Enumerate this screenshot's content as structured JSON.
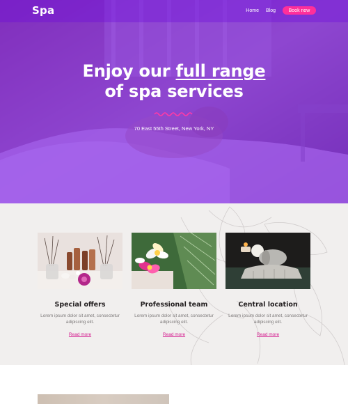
{
  "brand": {
    "logo": "Spa"
  },
  "nav": {
    "links": [
      "Home",
      "Blog"
    ],
    "cta_label": "Book now"
  },
  "hero": {
    "title_part1": "Enjoy our ",
    "title_highlight": "full range",
    "title_line2": "of spa services",
    "address": "70 East 55th Street, New York, NY"
  },
  "services": [
    {
      "title": "Special offers",
      "text": "Lorem ipsum dolor sit amet, consectetur adipiscing elit.",
      "link": "Read more"
    },
    {
      "title": "Professional team",
      "text": "Lorem ipsum dolor sit amet, consectetur adipiscing elit.",
      "link": "Read more"
    },
    {
      "title": "Central location",
      "text": "Lorem ipsum dolor sit amet, consectetur adipiscing elit.",
      "link": "Read more"
    }
  ],
  "colors": {
    "hero_overlay": "#7814eb",
    "accent_pink": "#ff2f9a",
    "link_pink": "#d51c8f",
    "section_bg": "#f1efee"
  }
}
